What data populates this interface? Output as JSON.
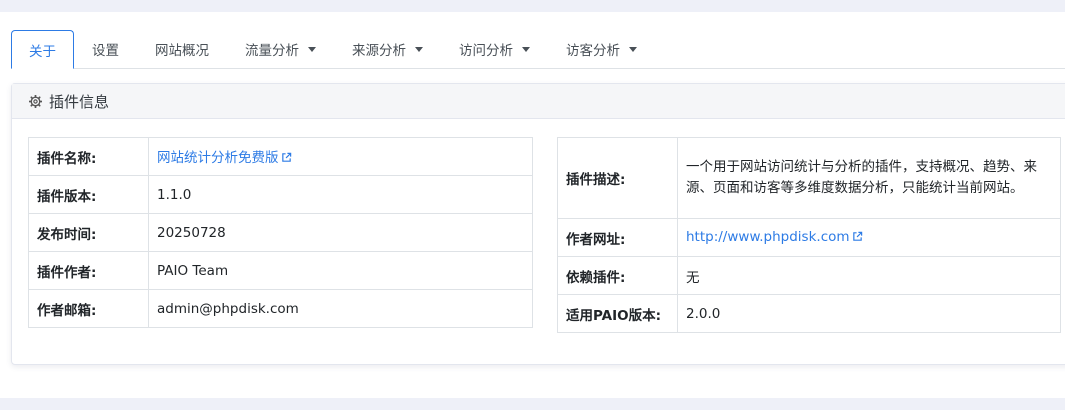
{
  "tabs": [
    {
      "label": "关于",
      "active": true,
      "dropdown": false
    },
    {
      "label": "设置",
      "active": false,
      "dropdown": false
    },
    {
      "label": "网站概况",
      "active": false,
      "dropdown": false
    },
    {
      "label": "流量分析",
      "active": false,
      "dropdown": true
    },
    {
      "label": "来源分析",
      "active": false,
      "dropdown": true
    },
    {
      "label": "访问分析",
      "active": false,
      "dropdown": true
    },
    {
      "label": "访客分析",
      "active": false,
      "dropdown": true
    }
  ],
  "card": {
    "title": "插件信息",
    "title_icon": "gear-icon"
  },
  "left_table": [
    {
      "key": "插件名称:",
      "value": "网站统计分析免费版",
      "link": true
    },
    {
      "key": "插件版本:",
      "value": "1.1.0"
    },
    {
      "key": "发布时间:",
      "value": "20250728"
    },
    {
      "key": "插件作者:",
      "value": "PAIO Team"
    },
    {
      "key": "作者邮箱:",
      "value": "admin@phpdisk.com"
    }
  ],
  "right_table": [
    {
      "key": "插件描述:",
      "value": "一个用于网站访问统计与分析的插件，支持概况、趋势、来源、页面和访客等多维度数据分析，只能统计当前网站。"
    },
    {
      "key": "作者网址:",
      "value": "http://www.phpdisk.com",
      "link": true
    },
    {
      "key": "依赖插件:",
      "value": "无"
    },
    {
      "key": "适用PAIO版本:",
      "value": "2.0.0"
    }
  ],
  "colors": {
    "accent": "#2d7be5",
    "border": "#dee2e6",
    "header_bg": "#f5f6f8"
  }
}
